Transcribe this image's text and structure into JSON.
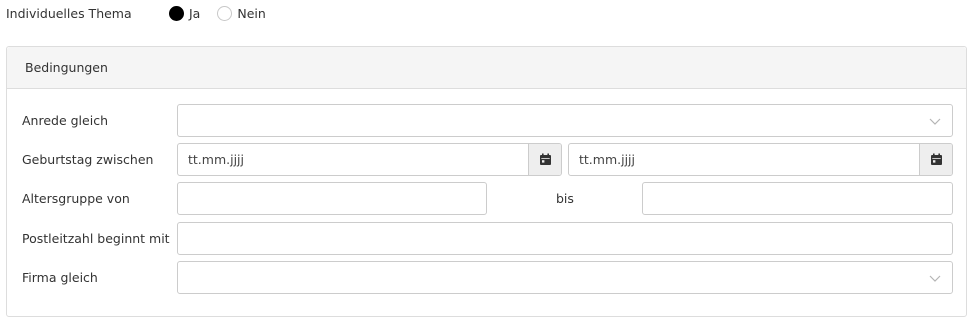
{
  "theme": {
    "label": "Individuelles Thema",
    "options": [
      {
        "label": "Ja",
        "checked": true
      },
      {
        "label": "Nein",
        "checked": false
      }
    ]
  },
  "panel": {
    "title": "Bedingungen",
    "rows": {
      "salutation": {
        "label": "Anrede gleich",
        "value": ""
      },
      "birthday": {
        "label": "Geburtstag zwischen",
        "from_placeholder": "tt.mm.jjjj",
        "to_placeholder": "tt.mm.jjjj"
      },
      "age_group": {
        "label": "Altersgruppe von",
        "separator": "bis",
        "from_value": "",
        "to_value": ""
      },
      "postal_code": {
        "label": "Postleitzahl beginnt mit",
        "value": ""
      },
      "company": {
        "label": "Firma gleich",
        "value": ""
      }
    }
  },
  "icons": {
    "calendar": "calendar-icon",
    "dropdown": "chevron-down-icon"
  }
}
